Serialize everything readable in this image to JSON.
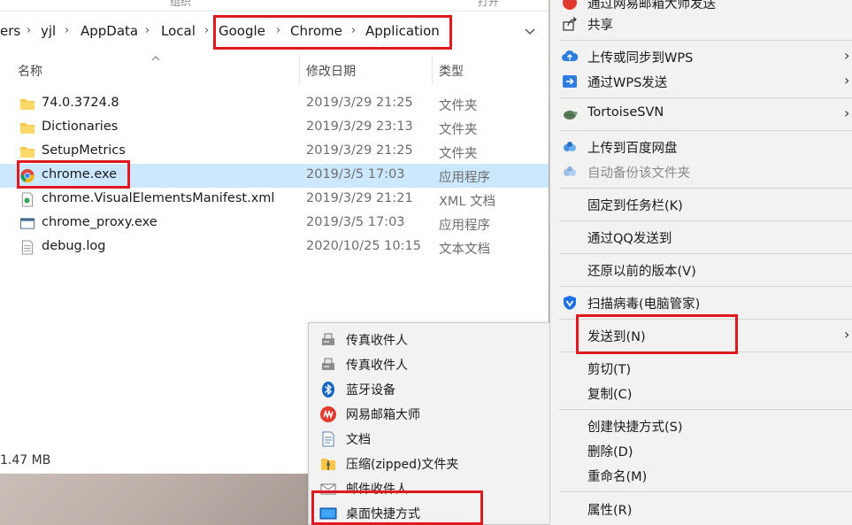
{
  "explorer": {
    "ribbon_fragments": [
      "组织",
      "打开"
    ],
    "breadcrumbs": [
      "ers",
      "yjl",
      "AppData",
      "Local",
      "Google",
      "Chrome",
      "Application"
    ],
    "columns": {
      "name": "名称",
      "date": "修改日期",
      "type": "类型"
    },
    "files": [
      {
        "name": "74.0.3724.8",
        "date": "2019/3/29 21:25",
        "type": "文件夹",
        "icon": "folder-icon"
      },
      {
        "name": "Dictionaries",
        "date": "2019/3/29 23:13",
        "type": "文件夹",
        "icon": "folder-icon"
      },
      {
        "name": "SetupMetrics",
        "date": "2019/3/29 21:25",
        "type": "文件夹",
        "icon": "folder-icon"
      },
      {
        "name": "chrome.exe",
        "date": "2019/3/5 17:03",
        "type": "应用程序",
        "icon": "chrome-icon",
        "selected": true
      },
      {
        "name": "chrome.VisualElementsManifest.xml",
        "date": "2019/3/29 21:21",
        "type": "XML 文档",
        "icon": "xml-file-icon"
      },
      {
        "name": "chrome_proxy.exe",
        "date": "2019/3/5 17:03",
        "type": "应用程序",
        "icon": "app-window-icon"
      },
      {
        "name": "debug.log",
        "date": "2020/10/25 10:15",
        "type": "文本文档",
        "icon": "text-file-icon"
      }
    ],
    "status_size": "1.47 MB"
  },
  "sendto_menu": {
    "items": [
      {
        "label": "传真收件人",
        "icon": "fax-icon"
      },
      {
        "label": "传真收件人",
        "icon": "fax-icon"
      },
      {
        "label": "蓝牙设备",
        "icon": "bluetooth-icon"
      },
      {
        "label": "网易邮箱大师",
        "icon": "netease-mail-icon"
      },
      {
        "label": "文档",
        "icon": "documents-icon"
      },
      {
        "label": "压缩(zipped)文件夹",
        "icon": "zip-folder-icon"
      },
      {
        "label": "邮件收件人",
        "icon": "mail-recipient-icon"
      },
      {
        "label": "桌面快捷方式",
        "icon": "desktop-icon"
      }
    ]
  },
  "context_menu": {
    "items": [
      {
        "label": "通过网易邮箱大师发送",
        "icon": "netease-mail-icon"
      },
      {
        "label": "共享",
        "icon": "share-icon"
      },
      {
        "label": "上传或同步到WPS",
        "icon": "wps-cloud-icon",
        "submenu": true
      },
      {
        "label": "通过WPS发送",
        "icon": "wps-send-icon",
        "submenu": true
      },
      {
        "label": "TortoiseSVN",
        "icon": "tortoisesvn-icon",
        "submenu": true
      },
      {
        "label": "上传到百度网盘",
        "icon": "baidu-netdisk-icon"
      },
      {
        "label": "自动备份该文件夹",
        "icon": "baidu-netdisk-icon",
        "disabled": true
      },
      {
        "label": "固定到任务栏(K)"
      },
      {
        "label": "通过QQ发送到"
      },
      {
        "label": "还原以前的版本(V)"
      },
      {
        "label": "扫描病毒(电脑管家)",
        "icon": "tencent-shield-icon"
      },
      {
        "label": "发送到(N)",
        "submenu": true
      },
      {
        "label": "剪切(T)"
      },
      {
        "label": "复制(C)"
      },
      {
        "label": "创建快捷方式(S)"
      },
      {
        "label": "删除(D)"
      },
      {
        "label": "重命名(M)"
      },
      {
        "label": "属性(R)"
      }
    ]
  },
  "colors": {
    "highlight_box": "#e0181f",
    "selection": "#cce8ff",
    "menu_bg": "#f2f2f2",
    "folder": "#f8c74a",
    "wps_blue": "#2f7de1",
    "netease_red": "#e23a2e"
  }
}
